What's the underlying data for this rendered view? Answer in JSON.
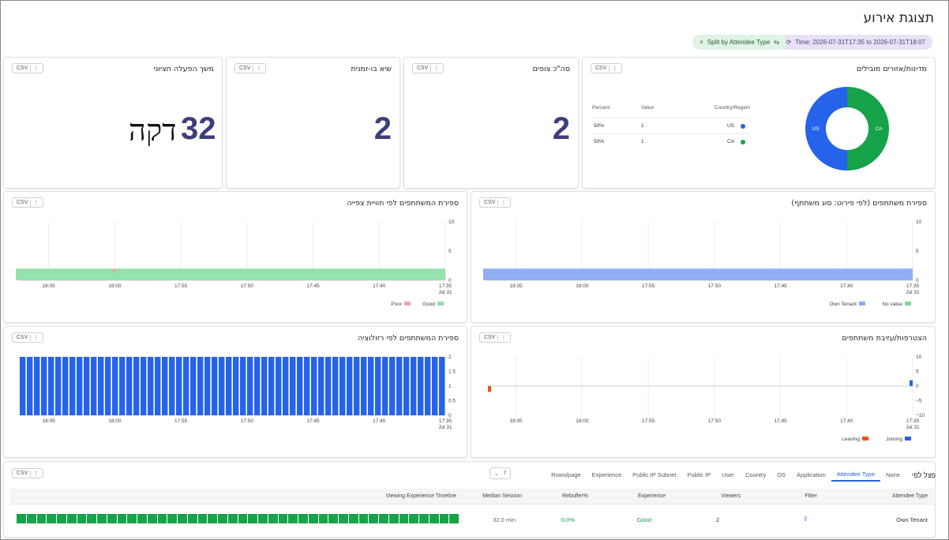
{
  "page": {
    "title": "תצוגת אירוע"
  },
  "filters": {
    "time": "Time: 2026-07-31T17:35 to 2026-07-31T18:07",
    "split": "Split by Attendee Type",
    "close": "×"
  },
  "common": {
    "csv": "CSV",
    "more": "⋮"
  },
  "cards": {
    "geo": {
      "title": "מדינות/אזורים מובילים"
    },
    "viewers": {
      "title": "סה\"כ צופים",
      "value": "2"
    },
    "concurrent": {
      "title": "שיא בו-זמנית",
      "value": "2"
    },
    "duration": {
      "title": "משך הפעלה חציוני",
      "value": "32",
      "unit": "דקה"
    },
    "attendee_type": {
      "title": "ספירת משתתפים (לפי פירוט: סוג משתתף)"
    },
    "experience": {
      "title": "ספירת המשתתפים לפי חוויית צפייה"
    },
    "joins": {
      "title": "הצטרפות/עזיבת משתתפים"
    },
    "resolution": {
      "title": "ספירת המשתתפים לפי רזולוציה"
    }
  },
  "geo_table": {
    "headers": {
      "region": "Country/Region",
      "value": "Value",
      "percent": "Percent"
    },
    "rows": [
      {
        "region": "US",
        "value": "1",
        "percent": "50%",
        "color": "#2563eb"
      },
      {
        "region": "CA",
        "value": "1",
        "percent": "50%",
        "color": "#16a34a"
      }
    ]
  },
  "chart_data": [
    {
      "type": "pie",
      "id": "geo-donut",
      "labels": [
        "CA",
        "US"
      ],
      "values": [
        1,
        1
      ],
      "colors": [
        "#16a34a",
        "#2563eb"
      ]
    },
    {
      "type": "area",
      "id": "attendee-type",
      "x": [
        "17:35",
        "17:40",
        "17:45",
        "17:50",
        "17:55",
        "18:00",
        "18:05"
      ],
      "x_sub": "Jul 31",
      "ylim": [
        0,
        10
      ],
      "yticks": [
        "10",
        "5",
        "0"
      ],
      "series": [
        {
          "name": "No value",
          "color": "#7fd89a",
          "values": [
            0,
            0,
            0,
            0,
            0,
            0,
            0
          ]
        },
        {
          "name": "Own Tenant",
          "color": "#8aa9f5",
          "values": [
            2,
            2,
            2,
            2,
            2,
            2,
            2
          ]
        }
      ]
    },
    {
      "type": "area",
      "id": "experience",
      "x": [
        "17:35",
        "17:40",
        "17:45",
        "17:50",
        "17:55",
        "18:00",
        "18:05"
      ],
      "x_sub": "Jul 31",
      "ylim": [
        0,
        10
      ],
      "yticks": [
        "10",
        "5",
        "0"
      ],
      "series": [
        {
          "name": "Good",
          "color": "#8ee0a8",
          "values": [
            2,
            2,
            2,
            2,
            2,
            2,
            2
          ]
        },
        {
          "name": "Poor",
          "color": "#f4a0a8",
          "values": [
            0,
            0,
            0,
            0,
            0,
            0,
            0
          ]
        }
      ]
    },
    {
      "type": "bar",
      "id": "joins",
      "x": [
        "17:35",
        "17:40",
        "17:45",
        "17:50",
        "17:55",
        "18:00",
        "18:05"
      ],
      "x_sub": "Jul 31",
      "ylim": [
        -10,
        10
      ],
      "yticks": [
        "10",
        "5",
        "0",
        "−5",
        "−10"
      ],
      "series": [
        {
          "name": "Joining",
          "color": "#2563eb",
          "values": [
            2,
            0,
            0,
            0,
            0,
            0,
            0
          ]
        },
        {
          "name": "Leaving",
          "color": "#ea580c",
          "values": [
            0,
            0,
            0,
            0,
            0,
            0,
            -2
          ]
        }
      ]
    },
    {
      "type": "bar",
      "id": "resolution",
      "x": [
        "17:35",
        "17:40",
        "17:45",
        "17:50",
        "17:55",
        "18:00",
        "18:05"
      ],
      "x_sub": "Jul 31",
      "ylim": [
        0,
        2
      ],
      "yticks": [
        "2",
        "1.5",
        "1",
        "0.5",
        "0"
      ],
      "series": [
        {
          "name": "",
          "color": "#2563eb",
          "values": [
            2,
            2,
            2,
            2,
            2,
            2,
            2
          ]
        }
      ]
    }
  ],
  "breakdown": {
    "label": "פצל לפי",
    "tabs": [
      "None",
      "Attendee Type",
      "Application",
      "OS",
      "Country",
      "User",
      "Public IP",
      "Public IP Subnet",
      "Experience"
    ],
    "active_tab": "Attendee Type",
    "rows_per_page_label": "Rows/page",
    "rows_per_page_value": "7"
  },
  "table": {
    "headers": [
      "Attendee Type",
      "Filter",
      "Viewers",
      "Experience",
      "Rebuffer%",
      "Median Session",
      "Viewing Experience Timeline"
    ],
    "rows": [
      {
        "attendee_type": "Own Tenant",
        "filter": "⊽",
        "viewers": "2",
        "experience": "Good",
        "rebuffer": "0.0%",
        "median": "32.0 min",
        "timeline_quality": "Good"
      }
    ]
  },
  "colors": {
    "good": "#16a34a",
    "accent": "#2b63d9",
    "kpi": "#3c3f7a"
  }
}
